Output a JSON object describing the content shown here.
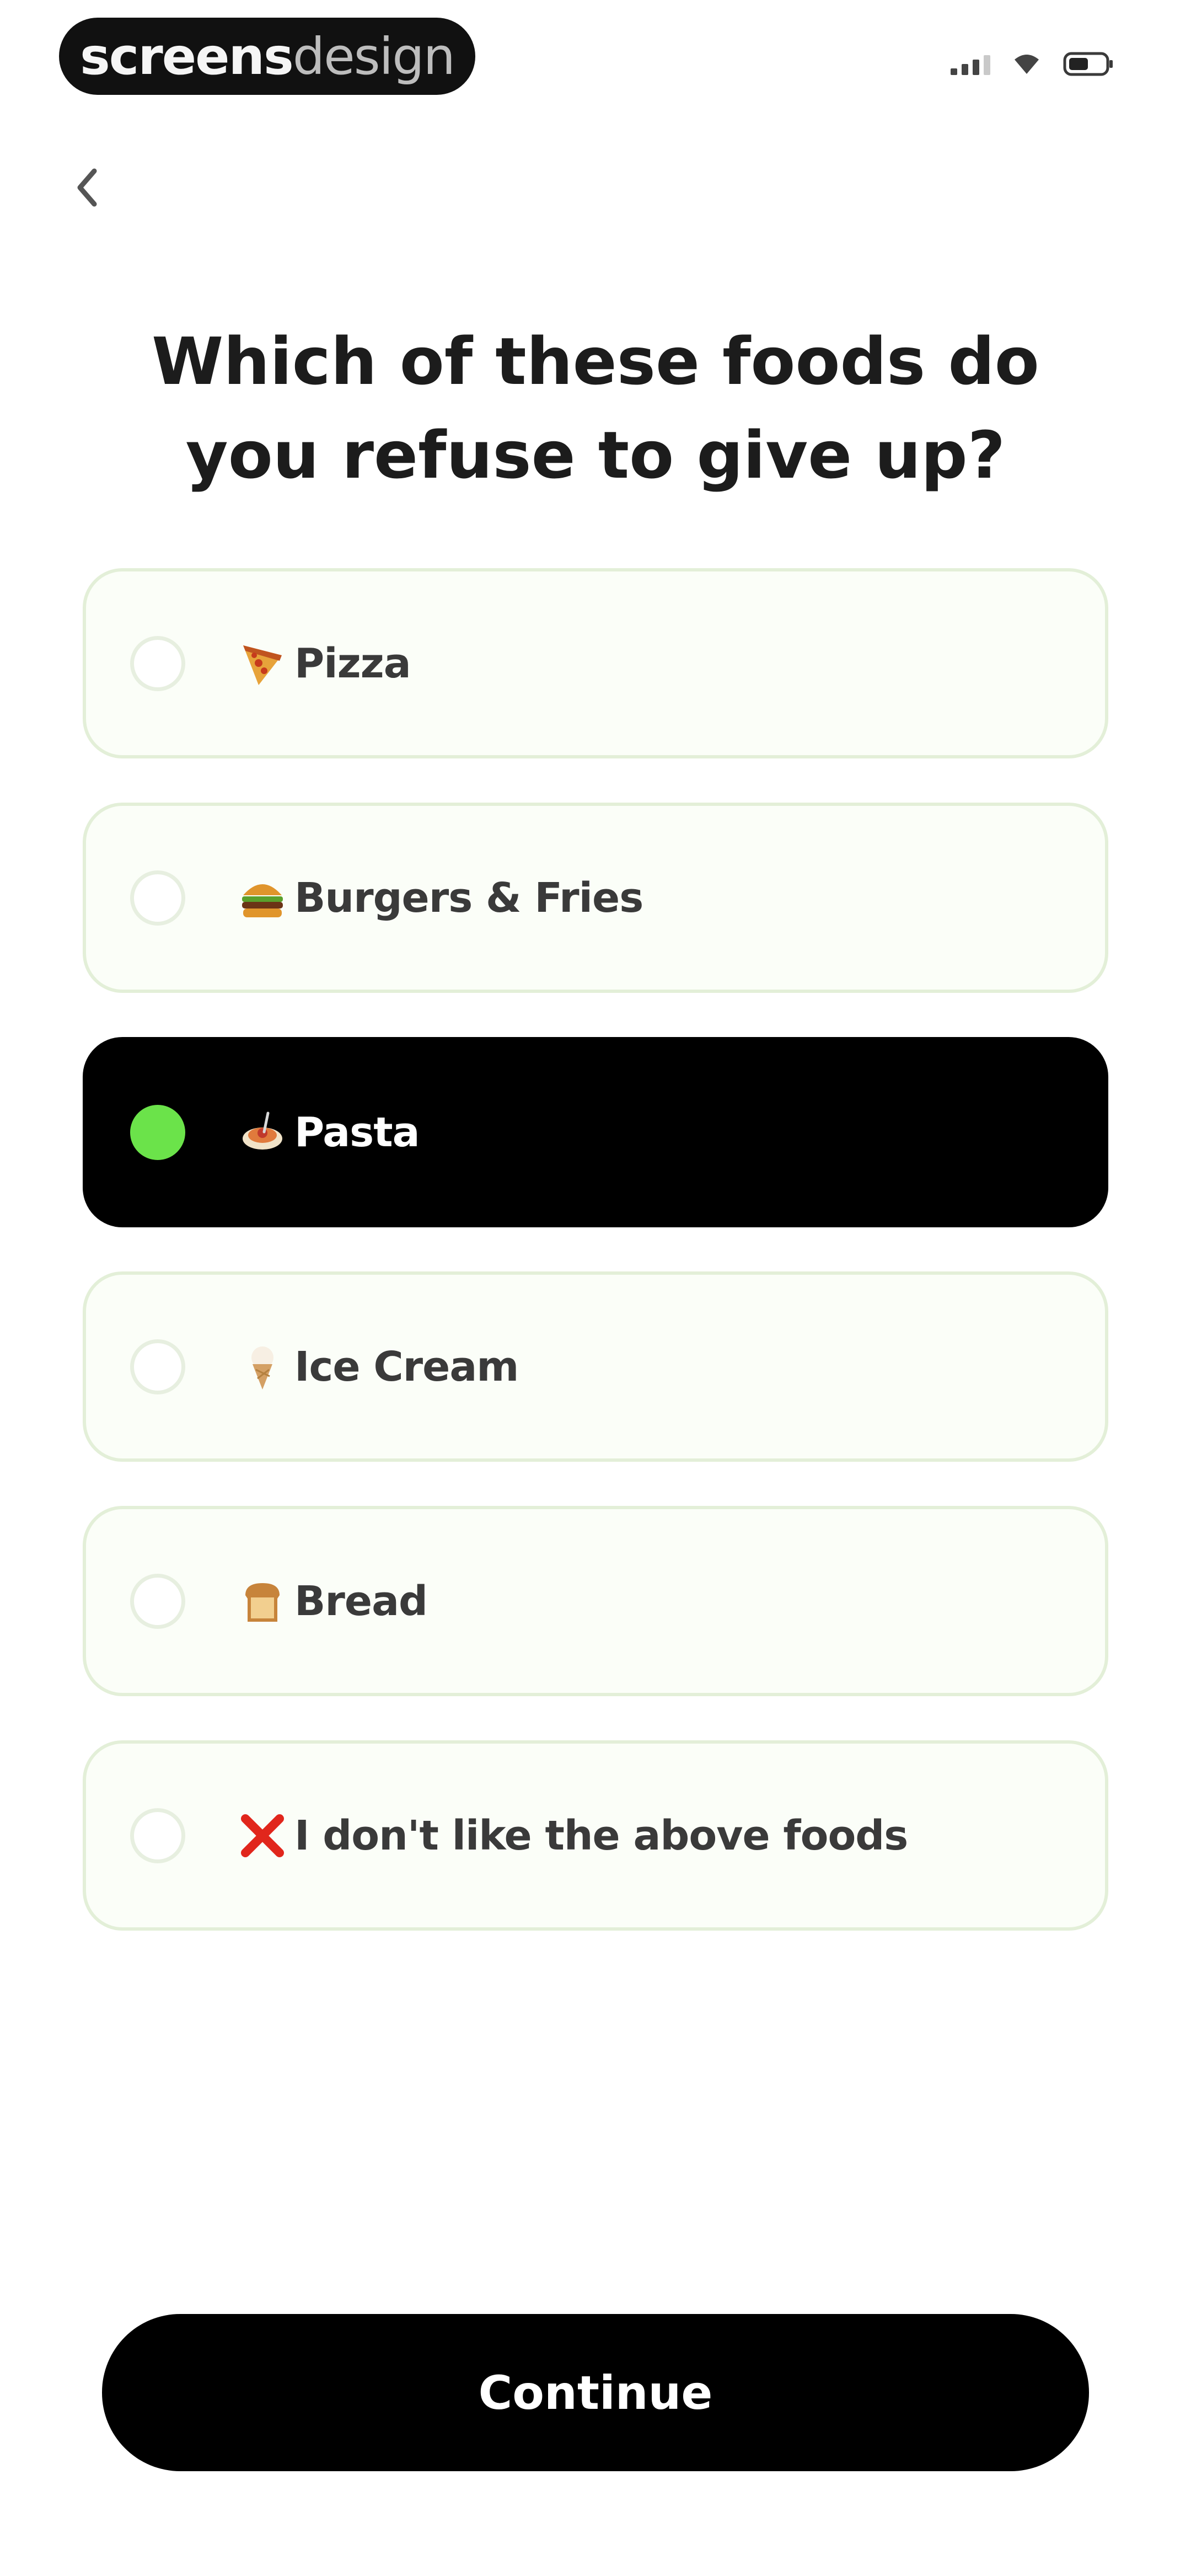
{
  "badge": {
    "text_bold": "screens",
    "text_light": "design"
  },
  "status_bar": {
    "icons": [
      "cellular-signal-icon",
      "wifi-icon",
      "battery-icon"
    ]
  },
  "navigation": {
    "back_icon": "chevron-left-icon"
  },
  "question": {
    "title": "Which of these foods do you refuse to give up?"
  },
  "options": [
    {
      "emoji": "pizza",
      "label": "Pizza",
      "selected": false
    },
    {
      "emoji": "burger",
      "label": "Burgers & Fries",
      "selected": false
    },
    {
      "emoji": "pasta",
      "label": "Pasta",
      "selected": true
    },
    {
      "emoji": "ice-cream",
      "label": "Ice Cream",
      "selected": false
    },
    {
      "emoji": "bread",
      "label": "Bread",
      "selected": false
    },
    {
      "emoji": "cross-mark",
      "label": "I don't like the above foods",
      "selected": false
    }
  ],
  "actions": {
    "continue_label": "Continue"
  },
  "colors": {
    "accent_selected": "#6be34a",
    "option_border": "#e3efd8",
    "option_background": "#fbfef8",
    "selected_background": "#000000",
    "button_background": "#000000"
  }
}
